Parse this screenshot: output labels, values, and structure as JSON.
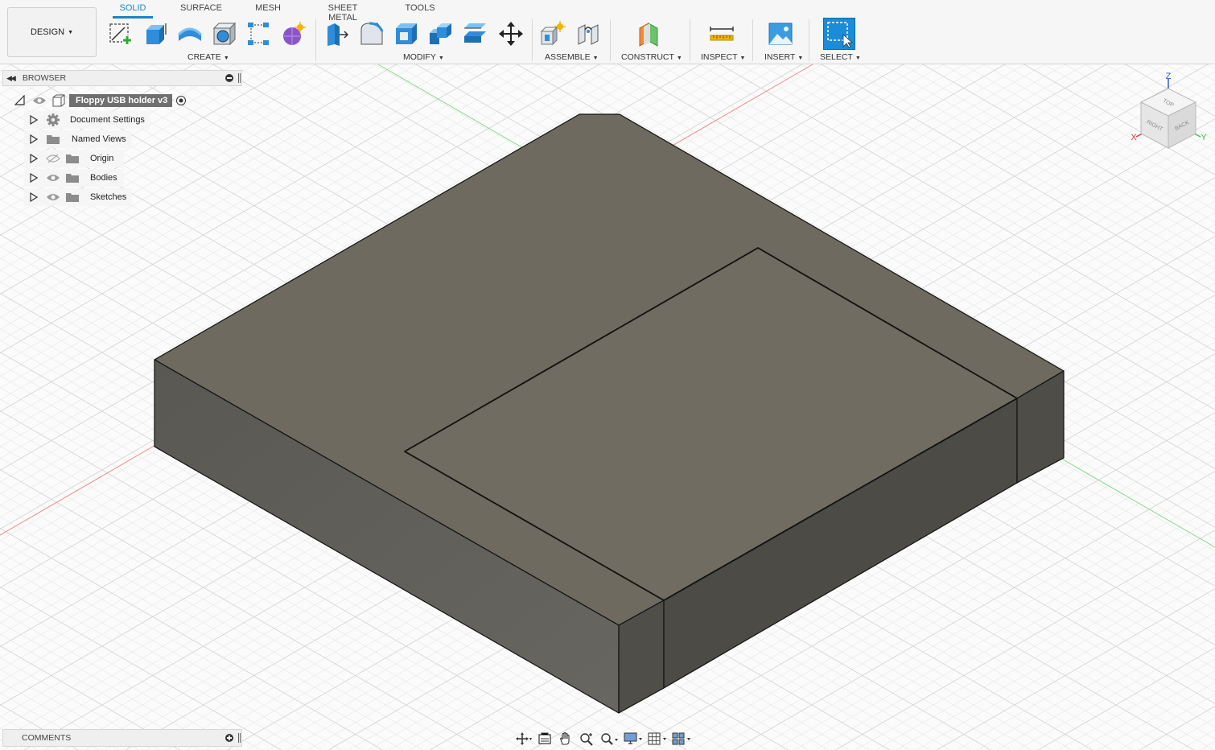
{
  "workspace": {
    "label": "DESIGN"
  },
  "tabs": [
    {
      "label": "SOLID",
      "active": true
    },
    {
      "label": "SURFACE",
      "active": false
    },
    {
      "label": "MESH",
      "active": false
    },
    {
      "label": "SHEET METAL",
      "active": false
    },
    {
      "label": "TOOLS",
      "active": false
    }
  ],
  "groups": {
    "create": "CREATE",
    "modify": "MODIFY",
    "assemble": "ASSEMBLE",
    "construct": "CONSTRUCT",
    "inspect": "INSPECT",
    "insert": "INSERT",
    "select": "SELECT"
  },
  "browser": {
    "title": "BROWSER",
    "root": "Floppy USB holder v3",
    "items": [
      {
        "label": "Document Settings",
        "icon": "gear-icon"
      },
      {
        "label": "Named Views",
        "icon": "folder-icon"
      },
      {
        "label": "Origin",
        "icon": "folder-icon",
        "visibility": "hidden"
      },
      {
        "label": "Bodies",
        "icon": "folder-icon",
        "visibility": "visible"
      },
      {
        "label": "Sketches",
        "icon": "folder-icon",
        "visibility": "visible"
      }
    ]
  },
  "viewcube": {
    "top": "TOP",
    "right": "RIGHT",
    "back": "BACK",
    "x": "X",
    "y": "Y",
    "z": "Z"
  },
  "comments": {
    "title": "COMMENTS"
  },
  "colors": {
    "accent": "#1c84c6",
    "model_top": "#6e6a5f",
    "model_side_front": "#5f5d58",
    "model_side_right": "#4c4b46",
    "x_axis": "#e03a3a",
    "y_axis": "#3ac43a",
    "z_axis": "#2f5bd6"
  }
}
